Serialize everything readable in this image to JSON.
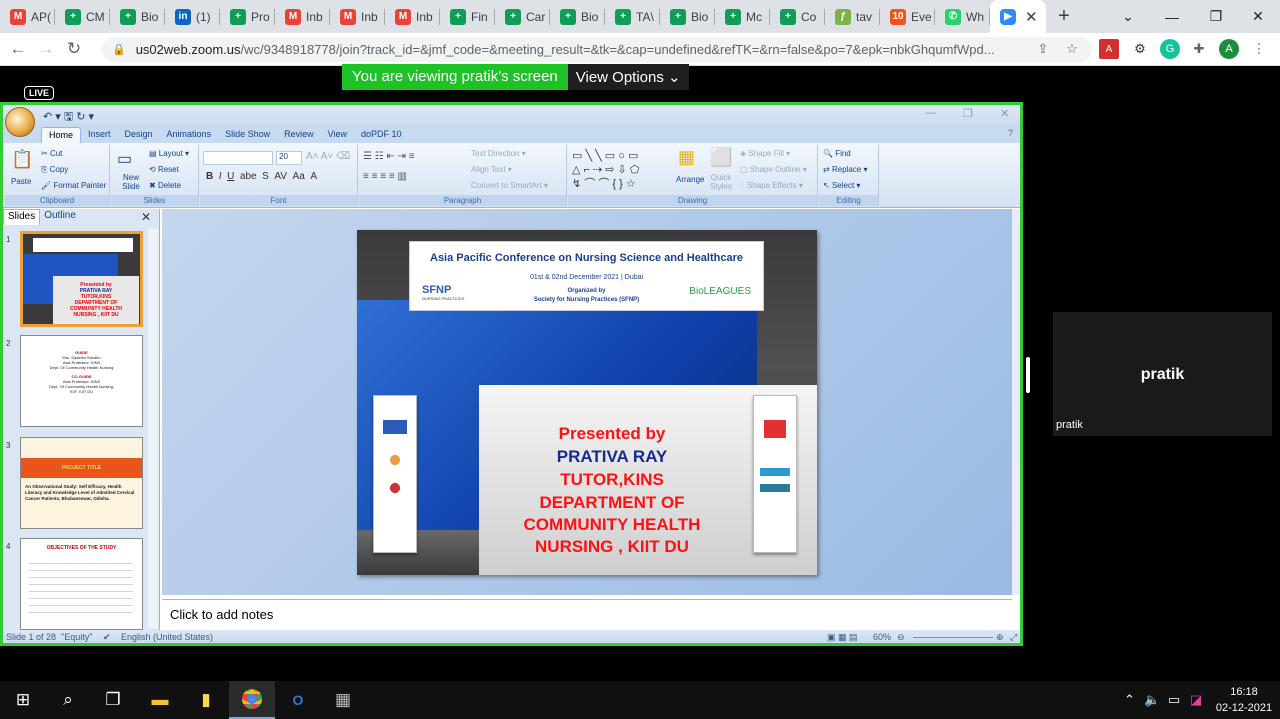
{
  "browser": {
    "tabs": [
      {
        "label": "AP(",
        "color": "#ea4335",
        "glyph": "M"
      },
      {
        "label": "CM",
        "color": "#0f9d58",
        "glyph": "+"
      },
      {
        "label": "Bio",
        "color": "#0f9d58",
        "glyph": "+"
      },
      {
        "label": "(1)",
        "color": "#0a66c2",
        "glyph": "in"
      },
      {
        "label": "Pro",
        "color": "#0f9d58",
        "glyph": "+"
      },
      {
        "label": "Inb",
        "color": "#ea4335",
        "glyph": "M"
      },
      {
        "label": "Inb",
        "color": "#ea4335",
        "glyph": "M"
      },
      {
        "label": "Inb",
        "color": "#ea4335",
        "glyph": "M"
      },
      {
        "label": "Fin",
        "color": "#0f9d58",
        "glyph": "+"
      },
      {
        "label": "Car",
        "color": "#0f9d58",
        "glyph": "+"
      },
      {
        "label": "Bio",
        "color": "#0f9d58",
        "glyph": "+"
      },
      {
        "label": "TA\\",
        "color": "#0f9d58",
        "glyph": "+"
      },
      {
        "label": "Bio",
        "color": "#0f9d58",
        "glyph": "+"
      },
      {
        "label": "Mc",
        "color": "#0f9d58",
        "glyph": "+"
      },
      {
        "label": "Co",
        "color": "#0f9d58",
        "glyph": "+"
      },
      {
        "label": "tav",
        "color": "#7cb342",
        "glyph": "ƒ"
      },
      {
        "label": "Eve",
        "color": "#f4511e",
        "glyph": "10"
      },
      {
        "label": "Wh",
        "color": "#25d366",
        "glyph": "✆"
      }
    ],
    "active_tab_color": "#2d8cff",
    "url_domain": "us02web.zoom.us",
    "url_path": "/wc/9348918778/join?track_id=&jmf_code=&meeting_result=&tk=&cap=undefined&refTK=&rn=false&po=7&epk=nbkGhqumfWpd...",
    "profile_initial": "A"
  },
  "zoom": {
    "live_label": "LIVE",
    "viewing_text": "You are viewing pratik's screen",
    "view_options": "View Options ⌄",
    "participant_name": "pratik",
    "participant_label": "pratik"
  },
  "ppt": {
    "tabs": [
      "Home",
      "Insert",
      "Design",
      "Animations",
      "Slide Show",
      "Review",
      "View",
      "doPDF 10"
    ],
    "groups": {
      "clipboard": {
        "name": "Clipboard",
        "paste": "Paste",
        "cut": "Cut",
        "copy": "Copy",
        "format_painter": "Format Painter"
      },
      "slides": {
        "name": "Slides",
        "new_slide": "New Slide",
        "layout": "Layout",
        "reset": "Reset",
        "delete": "Delete"
      },
      "font": {
        "name": "Font",
        "size": "20"
      },
      "paragraph": {
        "name": "Paragraph",
        "text_direction": "Text Direction",
        "align_text": "Align Text",
        "convert": "Convert to SmartArt"
      },
      "drawing": {
        "name": "Drawing",
        "arrange": "Arrange",
        "quick_styles": "Quick Styles",
        "shape_fill": "Shape Fill",
        "shape_outline": "Shape Outline",
        "shape_effects": "Shape Effects"
      },
      "editing": {
        "name": "Editing",
        "find": "Find",
        "replace": "Replace",
        "select": "Select"
      }
    },
    "panel_tabs": [
      "Slides",
      "Outline"
    ],
    "thumbnails": [
      {
        "num": "1"
      },
      {
        "num": "2",
        "title": "GUIDE",
        "lines": [
          "Mrs. Sasmita Saudhu",
          "Asst.Professor, KINS",
          "Dept. Of Community Health Nursing",
          "CO-GUIDE",
          "Asst.Professor, KINS",
          "Dept. Of Community Health Nursing,",
          "KIIT, KIIT DU"
        ]
      },
      {
        "num": "3",
        "title": "PROJECT TITLE",
        "body": "An Observational Study: Self Efficacy, Health Literacy and Knowledge Level of Admitted Cervical Cancer Patients, Bhubaneswar, Odisha."
      },
      {
        "num": "4",
        "title": "OBJECTIVES OF THE STUDY"
      }
    ],
    "slide": {
      "conf_title": "Asia Pacific Conference on Nursing Science and Healthcare",
      "dates": "01st & 02nd December 2021 | Dubai",
      "organized_by": "Organized by",
      "organizer": "Society for Nursing Practices (SFNP)",
      "sfnp": "SFNP",
      "sfnp_sub": "NURSING PRACTICES",
      "bioleagues": "BioLEAGUES",
      "presented_by": "Presented by",
      "name": "PRATIVA RAY",
      "role": "TUTOR,KINS",
      "dept1": "DEPARTMENT OF",
      "dept2": "COMMUNITY HEALTH",
      "dept3": "NURSING , KIIT DU"
    },
    "notes_placeholder": "Click to add notes",
    "status": {
      "slide_count": "Slide 1 of 28",
      "theme": "\"Equity\"",
      "language": "English (United States)",
      "zoom": "60%"
    }
  },
  "taskbar": {
    "time": "16:18",
    "date": "02-12-2021"
  }
}
